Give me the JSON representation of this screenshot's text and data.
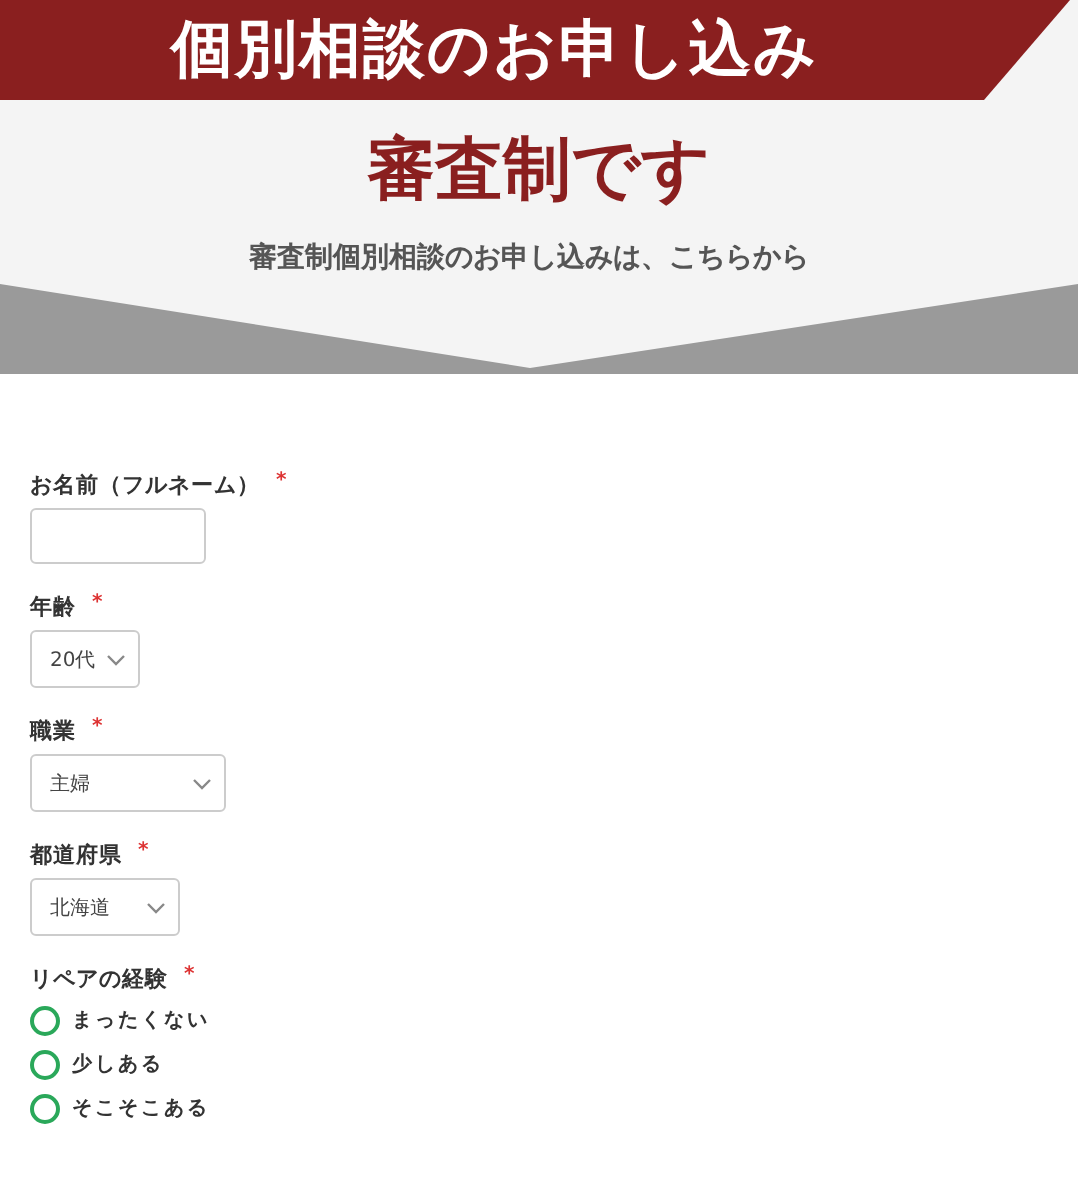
{
  "banner": {
    "title": "個別相談のお申し込み",
    "headline": "審査制です",
    "subtitle": "審査制個別相談のお申し込みは、こちらから"
  },
  "form": {
    "fields": [
      {
        "kind": "text",
        "label": "お名前（フルネーム）",
        "required_mark": "*"
      },
      {
        "kind": "select",
        "label": "年齢",
        "required_mark": "*",
        "value": "20代"
      },
      {
        "kind": "select",
        "label": "職業",
        "required_mark": "*",
        "value": "主婦"
      },
      {
        "kind": "select",
        "label": "都道府県",
        "required_mark": "*",
        "value": "北海道"
      },
      {
        "kind": "radio",
        "label": "リペアの経験",
        "required_mark": "*",
        "options": [
          {
            "label": "まったくない",
            "selected": false
          },
          {
            "label": "少しある",
            "selected": false
          },
          {
            "label": "そこそこある",
            "selected": false
          }
        ]
      }
    ]
  }
}
